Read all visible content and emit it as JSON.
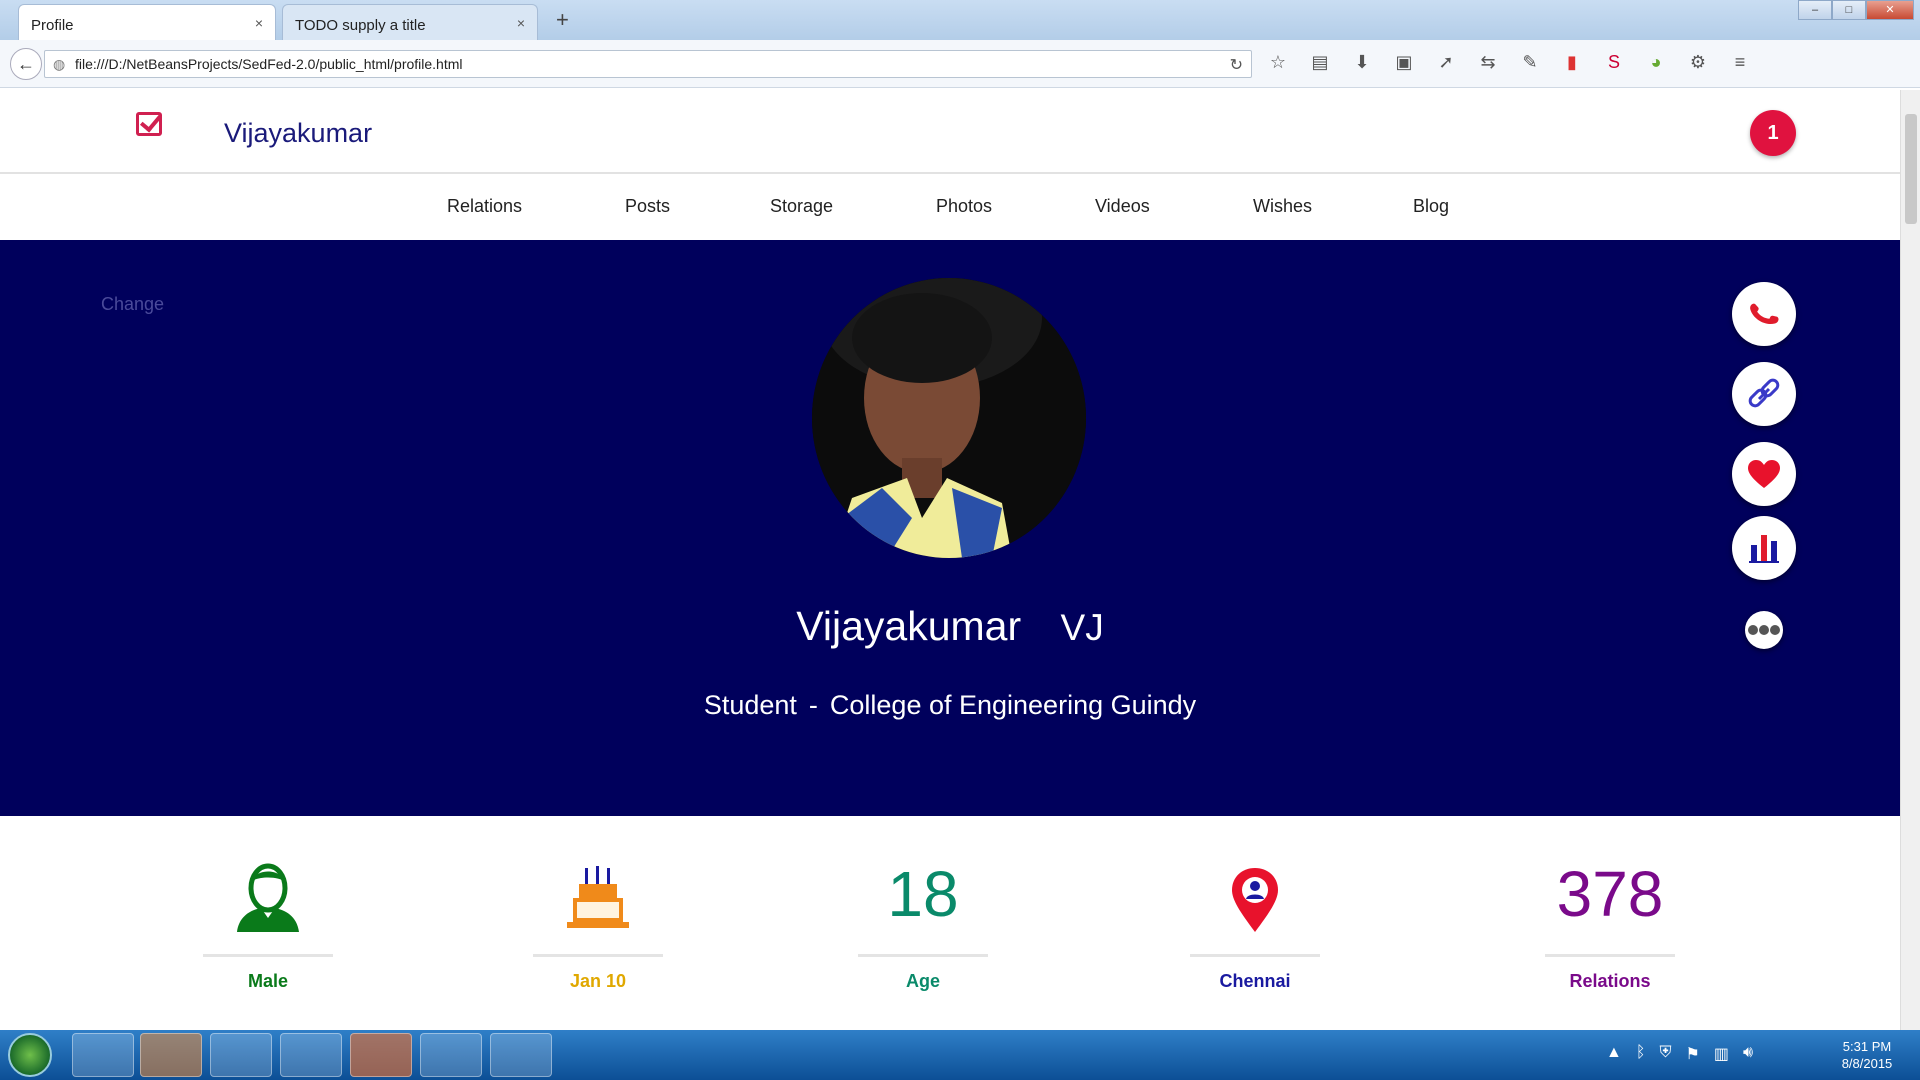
{
  "browser": {
    "tabs": [
      {
        "label": "Profile",
        "active": true
      },
      {
        "label": "TODO supply a title",
        "active": false
      }
    ],
    "new_tab_glyph": "+",
    "close_glyph": "×",
    "url": "file:///D:/NetBeansProjects/SedFed-2.0/public_html/profile.html",
    "window_controls": [
      "–",
      "□",
      "✕"
    ]
  },
  "header": {
    "brand": "Vijayakumar",
    "notification_count": "1",
    "brand_color": "#d02050"
  },
  "nav": {
    "items": [
      "Relations",
      "Posts",
      "Storage",
      "Photos",
      "Videos",
      "Wishes",
      "Blog"
    ]
  },
  "hero": {
    "change_label": "Change",
    "first_name": "Vijayakumar",
    "nickname": "VJ",
    "role": "Student",
    "separator": "-",
    "institution": "College of Engineering Guindy",
    "background": "#00005c"
  },
  "actions": [
    {
      "icon": "phone-icon"
    },
    {
      "icon": "link-icon"
    },
    {
      "icon": "heart-icon"
    },
    {
      "icon": "bar-chart-icon"
    },
    {
      "icon": "more-icon"
    }
  ],
  "stats": {
    "gender": {
      "label": "Male",
      "icon": "user-icon",
      "color": "#0a7a1a"
    },
    "birthday": {
      "label": "Jan 10",
      "icon": "cake-icon",
      "color": "#e0a800"
    },
    "age": {
      "value": "18",
      "label": "Age",
      "color": "#0a8a6a"
    },
    "location": {
      "label": "Chennai",
      "icon": "location-pin-icon",
      "color": "#1a1aa0"
    },
    "relations": {
      "value": "378",
      "label": "Relations",
      "color": "#7a0a8a"
    }
  },
  "taskbar": {
    "time": "5:31 PM",
    "date": "8/8/2015"
  }
}
